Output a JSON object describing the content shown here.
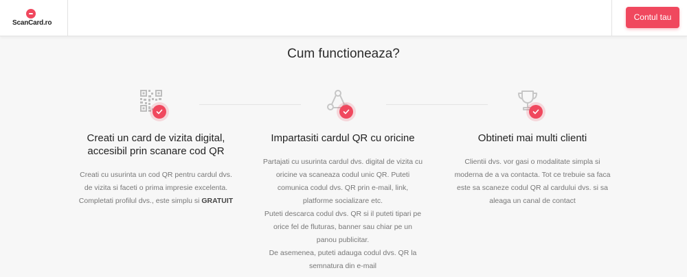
{
  "brand": {
    "name": "ScanCard.ro",
    "accent": "#f0485e"
  },
  "header": {
    "account_button": "Contul tau"
  },
  "section": {
    "title": "Cum functioneaza?"
  },
  "steps": [
    {
      "icon": "qr-code-icon",
      "title_line1": "Creati un card de vizita digital,",
      "title_line2": "accesibil prin scanare cod QR",
      "text_line1": "Creati cu usurinta un cod QR pentru cardul dvs.",
      "text_line2": "de vizita si faceti o prima impresie excelenta.",
      "text_line3": "Completati profilul dvs., este simplu si",
      "text_bold": "GRATUIT"
    },
    {
      "icon": "share-icon",
      "title": "Impartasiti cardul QR cu oricine",
      "para1": "Partajati cu usurinta cardul dvs. digital de vizita cu oricine va scaneaza codul unic QR. Puteti comunica codul dvs. QR prin e-mail, link, platforme socializare etc.",
      "para2": "Puteti descarca codul dvs. QR si il puteti tipari pe orice fel de fluturas, banner sau chiar pe un panou publicitar.",
      "para3": "De asemenea, puteti adauga codul dvs. QR la semnatura din e-mail"
    },
    {
      "icon": "trophy-icon",
      "title": "Obtineti mai multi clienti",
      "text": "Clientii dvs. vor gasi o modalitate simpla si moderna de a va contacta. Tot ce trebuie sa faca este sa scaneze codul QR al cardului dvs. si sa aleaga un canal de contact"
    }
  ]
}
